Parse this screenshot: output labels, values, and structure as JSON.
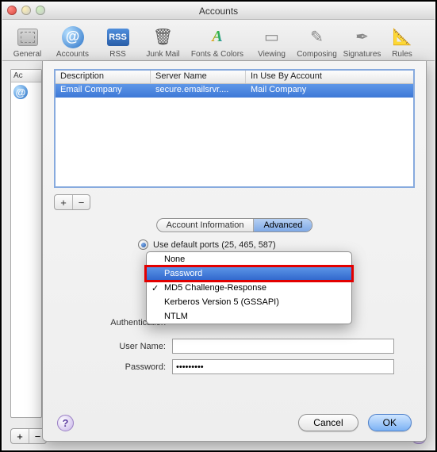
{
  "window": {
    "title": "Accounts"
  },
  "toolbar": {
    "items": [
      {
        "label": "General"
      },
      {
        "label": "Accounts"
      },
      {
        "label": "RSS",
        "badge": "RSS"
      },
      {
        "label": "Junk Mail"
      },
      {
        "label": "Fonts & Colors"
      },
      {
        "label": "Viewing"
      },
      {
        "label": "Composing"
      },
      {
        "label": "Signatures"
      },
      {
        "label": "Rules"
      }
    ]
  },
  "left_list": {
    "header": "Ac"
  },
  "sheet": {
    "table": {
      "headers": {
        "description": "Description",
        "server": "Server Name",
        "inuse": "In Use By Account"
      },
      "row": {
        "description": "Email Company",
        "server": "secure.emailsrvr....",
        "inuse": "Mail Company"
      }
    },
    "plus": "+",
    "minus": "−",
    "tabs": {
      "info": "Account Information",
      "advanced": "Advanced"
    },
    "radio_ports": "Use default ports (25, 465, 587)",
    "auth_menu": {
      "options": [
        "None",
        "Password",
        "MD5 Challenge-Response",
        "Kerberos Version 5 (GSSAPI)",
        "NTLM"
      ],
      "selected_index": 1,
      "checked_index": 2
    },
    "labels": {
      "authentication": "Authentication",
      "username": "User Name:",
      "password": "Password:"
    },
    "values": {
      "username": "",
      "password": "•••••••••"
    },
    "buttons": {
      "cancel": "Cancel",
      "ok": "OK"
    },
    "help": "?"
  },
  "bottom": {
    "plus": "+",
    "minus": "−",
    "help": "?"
  }
}
